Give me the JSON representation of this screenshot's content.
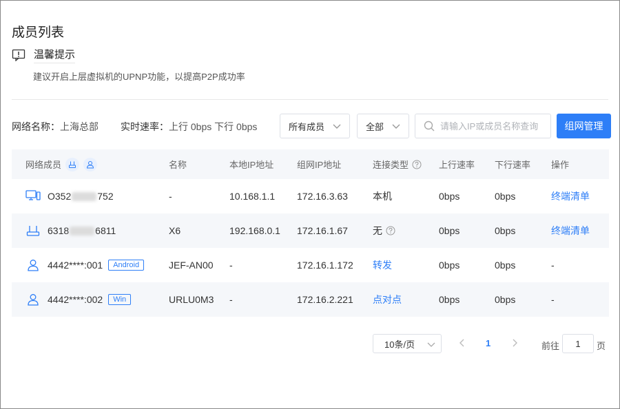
{
  "page": {
    "title": "成员列表"
  },
  "tip": {
    "icon": "info-icon",
    "title": "温馨提示",
    "text": "建议开启上层虚拟机的UPNP功能，以提高P2P成功率"
  },
  "toolbar": {
    "network_label": "网络名称：",
    "network_value": "上海总部",
    "speed_label": "实时速率：",
    "speed_value": "上行 0bps 下行 0bps",
    "member_filter": "所有成员",
    "type_filter": "全部",
    "search_placeholder": "请输入IP或成员名称查询",
    "manage_button": "组网管理"
  },
  "table": {
    "headers": [
      "网络成员",
      "名称",
      "本地IP地址",
      "组网IP地址",
      "连接类型",
      "上行速率",
      "下行速率",
      "操作"
    ],
    "rows": [
      {
        "icon": "monitor-icon",
        "member_prefix": "O352",
        "member_suffix": "752",
        "tag": "",
        "name": "-",
        "local_ip": "10.168.1.1",
        "net_ip": "172.16.3.63",
        "conn": "本机",
        "up": "0bps",
        "down": "0bps",
        "action": "终端清单"
      },
      {
        "icon": "router-icon",
        "member_prefix": "6318",
        "member_suffix": "6811",
        "tag": "",
        "name": "X6",
        "local_ip": "192.168.0.1",
        "net_ip": "172.16.1.67",
        "conn": "无",
        "up": "0bps",
        "down": "0bps",
        "action": "终端清单"
      },
      {
        "icon": "user-icon",
        "member_prefix": "4442****:001",
        "member_suffix": "",
        "tag": "Android",
        "name": "JEF-AN00",
        "local_ip": "-",
        "net_ip": "172.16.1.172",
        "conn": "转发",
        "up": "0bps",
        "down": "0bps",
        "action": "-"
      },
      {
        "icon": "user-icon",
        "member_prefix": "4442****:002",
        "member_suffix": "",
        "tag": "Win",
        "name": "URLU0M3",
        "local_ip": "-",
        "net_ip": "172.16.2.221",
        "conn": "点对点",
        "up": "0bps",
        "down": "0bps",
        "action": "-"
      }
    ]
  },
  "pagination": {
    "page_size": "10条/页",
    "current_page": "1",
    "goto_label": "前往",
    "goto_value": "1",
    "goto_suffix": "页"
  },
  "colors": {
    "accent": "#2d7ef7",
    "row_alt": "#f5f7fa",
    "border": "#dcdfe6"
  }
}
